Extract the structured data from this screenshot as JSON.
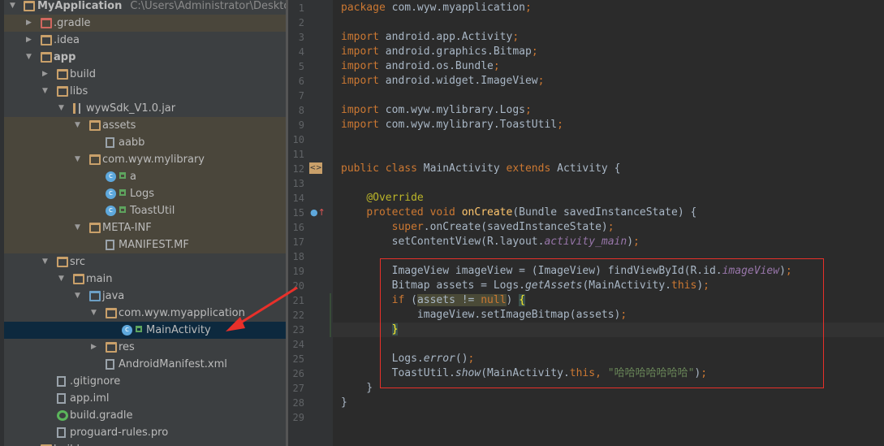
{
  "project": {
    "name": "MyApplication",
    "path": "C:\\Users\\Administrator\\Desktop\\My"
  },
  "tree": [
    {
      "label": ".gradle",
      "lvl": 1,
      "arrow": "r",
      "icon": "folder-red",
      "hl": "lib"
    },
    {
      "label": ".idea",
      "lvl": 1,
      "arrow": "r",
      "icon": "folder"
    },
    {
      "label": "app",
      "lvl": 1,
      "arrow": "d",
      "icon": "module",
      "bold": true
    },
    {
      "label": "build",
      "lvl": 2,
      "arrow": "r",
      "icon": "folder"
    },
    {
      "label": "libs",
      "lvl": 2,
      "arrow": "d",
      "icon": "folder"
    },
    {
      "label": "wywSdk_V1.0.jar",
      "lvl": 3,
      "arrow": "d",
      "icon": "jar"
    },
    {
      "label": "assets",
      "lvl": 4,
      "arrow": "d",
      "icon": "package",
      "hl": "lib"
    },
    {
      "label": "aabb",
      "lvl": 5,
      "icon": "unknown-file",
      "hl": "lib"
    },
    {
      "label": "com.wyw.mylibrary",
      "lvl": 4,
      "arrow": "d",
      "icon": "package",
      "hl": "lib"
    },
    {
      "label": "a",
      "lvl": 5,
      "icon": "class",
      "lock": true,
      "hl": "lib"
    },
    {
      "label": "Logs",
      "lvl": 5,
      "icon": "class",
      "lock": true,
      "hl": "lib"
    },
    {
      "label": "ToastUtil",
      "lvl": 5,
      "icon": "class",
      "lock": true,
      "hl": "lib"
    },
    {
      "label": "META-INF",
      "lvl": 4,
      "arrow": "d",
      "icon": "package",
      "hl": "lib"
    },
    {
      "label": "MANIFEST.MF",
      "lvl": 5,
      "icon": "manifest-file",
      "hl": "lib"
    },
    {
      "label": "src",
      "lvl": 2,
      "arrow": "d",
      "icon": "folder"
    },
    {
      "label": "main",
      "lvl": 3,
      "arrow": "d",
      "icon": "folder"
    },
    {
      "label": "java",
      "lvl": 4,
      "arrow": "d",
      "icon": "folder-blue"
    },
    {
      "label": "com.wyw.myapplication",
      "lvl": 5,
      "arrow": "d",
      "icon": "package"
    },
    {
      "label": "MainActivity",
      "lvl": 6,
      "icon": "class",
      "lock": true,
      "hl": "sel"
    },
    {
      "label": "res",
      "lvl": 5,
      "arrow": "r",
      "icon": "res-folder"
    },
    {
      "label": "AndroidManifest.xml",
      "lvl": 5,
      "icon": "xml-file"
    },
    {
      "label": ".gitignore",
      "lvl": 2,
      "icon": "file"
    },
    {
      "label": "app.iml",
      "lvl": 2,
      "icon": "file"
    },
    {
      "label": "build.gradle",
      "lvl": 2,
      "icon": "gradle"
    },
    {
      "label": "proguard-rules.pro",
      "lvl": 2,
      "icon": "file"
    },
    {
      "label": "build",
      "lvl": 1,
      "arrow": "r",
      "icon": "folder"
    }
  ],
  "code": [
    [
      [
        "package ",
        "kw"
      ],
      [
        "com.wyw.myapplication",
        ""
      ],
      [
        ";",
        "kw"
      ]
    ],
    [],
    [
      [
        "import ",
        "kw"
      ],
      [
        "android.app.Activity",
        ""
      ],
      [
        ";",
        "kw"
      ]
    ],
    [
      [
        "import ",
        "kw"
      ],
      [
        "android.graphics.Bitmap",
        ""
      ],
      [
        ";",
        "kw"
      ]
    ],
    [
      [
        "import ",
        "kw"
      ],
      [
        "android.os.Bundle",
        ""
      ],
      [
        ";",
        "kw"
      ]
    ],
    [
      [
        "import ",
        "kw"
      ],
      [
        "android.widget.ImageView",
        ""
      ],
      [
        ";",
        "kw"
      ]
    ],
    [],
    [
      [
        "import ",
        "kw"
      ],
      [
        "com.wyw.mylibrary.Logs",
        ""
      ],
      [
        ";",
        "kw"
      ]
    ],
    [
      [
        "import ",
        "kw"
      ],
      [
        "com.wyw.mylibrary.ToastUtil",
        ""
      ],
      [
        ";",
        "kw"
      ]
    ],
    [],
    [],
    [
      [
        "public class ",
        "kw"
      ],
      [
        "MainActivity ",
        ""
      ],
      [
        "extends ",
        "kw"
      ],
      [
        "Activity {",
        ""
      ]
    ],
    [],
    [
      [
        "    ",
        ""
      ],
      [
        "@Override",
        "an"
      ]
    ],
    [
      [
        "    ",
        ""
      ],
      [
        "protected void ",
        "kw"
      ],
      [
        "onCreate",
        "fn"
      ],
      [
        "(Bundle savedInstanceState) {",
        ""
      ]
    ],
    [
      [
        "        ",
        ""
      ],
      [
        "super",
        "kw"
      ],
      [
        ".onCreate(savedInstanceState)",
        ""
      ],
      [
        ";",
        "kw"
      ]
    ],
    [
      [
        "        setContentView(R.layout.",
        ""
      ],
      [
        "activity_main",
        "pu"
      ],
      [
        ")",
        ""
      ],
      [
        ";",
        "kw"
      ]
    ],
    [],
    [
      [
        "        ImageView imageView = (ImageView) findViewById(R.id.",
        ""
      ],
      [
        "imageView",
        "pu"
      ],
      [
        ")",
        ""
      ],
      [
        ";",
        "kw"
      ]
    ],
    [
      [
        "        Bitmap assets = Logs.",
        ""
      ],
      [
        "getAssets",
        "it"
      ],
      [
        "(MainActivity.",
        ""
      ],
      [
        "this",
        "kw"
      ],
      [
        ")",
        ""
      ],
      [
        ";",
        "kw"
      ]
    ],
    [
      [
        "        ",
        ""
      ],
      [
        "if ",
        "kw"
      ],
      [
        "(",
        ""
      ],
      [
        "assets != ",
        "hl"
      ],
      [
        "null",
        "kw hl"
      ],
      [
        ") ",
        ""
      ],
      [
        "{",
        "br"
      ]
    ],
    [
      [
        "            imageView.setImageBitmap(assets)",
        ""
      ],
      [
        ";",
        "kw"
      ]
    ],
    [
      [
        "        ",
        ""
      ],
      [
        "}",
        "br"
      ]
    ],
    [],
    [
      [
        "        Logs.",
        ""
      ],
      [
        "error",
        "it"
      ],
      [
        "()",
        ""
      ],
      [
        ";",
        "kw"
      ]
    ],
    [
      [
        "        ToastUtil.",
        ""
      ],
      [
        "show",
        "it"
      ],
      [
        "(MainActivity.",
        ""
      ],
      [
        "this",
        "kw"
      ],
      [
        ", ",
        "kw"
      ],
      [
        "\"哈哈哈哈哈哈哈\"",
        "st"
      ],
      [
        ")",
        ""
      ],
      [
        ";",
        "kw"
      ]
    ],
    [
      [
        "    }",
        ""
      ]
    ],
    [
      [
        "}",
        ""
      ]
    ],
    []
  ]
}
